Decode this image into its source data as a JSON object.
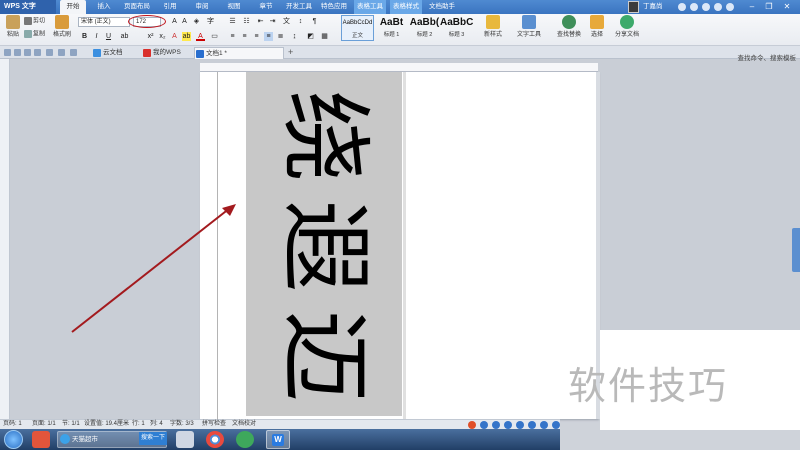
{
  "titlebar": {
    "app_name": "WPS 文字",
    "menus": [
      "开始",
      "插入",
      "页面布局",
      "引用",
      "审阅",
      "视图",
      "章节",
      "开发工具",
      "特色应用",
      "表格工具",
      "表格样式",
      "文档助手"
    ],
    "active_menu": "开始",
    "user_name": "丁嘉尚"
  },
  "ribbon": {
    "paste": "粘贴",
    "cut": "剪切",
    "copy": "复制",
    "format_painter": "格式刷",
    "font_name": "宋体 (正文)",
    "font_size": "172",
    "styles": [
      {
        "sample": "AaBbCcDd",
        "name": "正文"
      },
      {
        "sample": "AaBt",
        "name": "标题 1"
      },
      {
        "sample": "AaBb(",
        "name": "标题 2"
      },
      {
        "sample": "AaBbC",
        "name": "标题 3"
      }
    ],
    "new_style": "新样式",
    "text_tools": "文字工具",
    "find_replace": "查找替换",
    "select": "选择",
    "share_doc": "分享文档",
    "search_hint": "查找命令、搜索模板"
  },
  "tabs": [
    {
      "label": "云文档"
    },
    {
      "label": "我的WPS"
    },
    {
      "label": "文档1 *"
    }
  ],
  "document": {
    "characters": [
      "绕",
      "遐",
      "迈"
    ]
  },
  "watermark": "软件技巧",
  "statusbar": {
    "page": "页码: 1",
    "pages": "页面: 1/1",
    "section": "节: 1/1",
    "setting": "设置值: 19.4厘米",
    "row": "行: 1",
    "col": "列: 4",
    "words": "字数: 3/3",
    "spell": "拼写检查",
    "proof": "文档校对"
  },
  "taskbar": {
    "ie_label": "天猫超市",
    "search_btn": "搜索一下"
  },
  "colors": {
    "accent": "#3a74c0",
    "annotation_red": "#c0141c",
    "text_frame_bg": "#c8c8c8"
  }
}
